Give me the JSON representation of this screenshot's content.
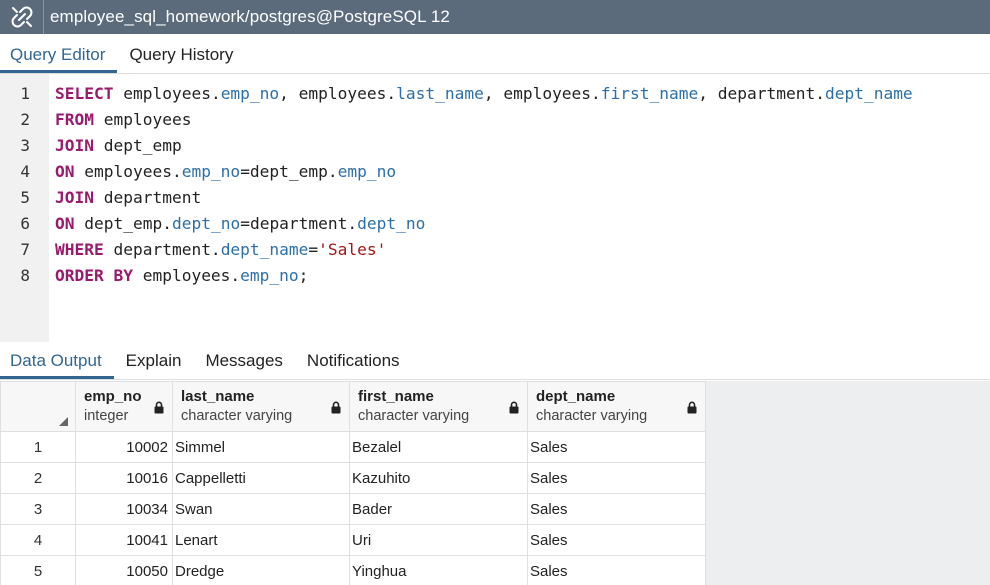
{
  "window": {
    "title": "employee_sql_homework/postgres@PostgreSQL 12",
    "icon": "connection-plug-icon"
  },
  "editor_tabs": [
    {
      "label": "Query Editor",
      "active": true
    },
    {
      "label": "Query History",
      "active": false
    }
  ],
  "editor": {
    "line_numbers": [
      "1",
      "2",
      "3",
      "4",
      "5",
      "6",
      "7",
      "8"
    ]
  },
  "output_tabs": [
    {
      "label": "Data Output",
      "active": true
    },
    {
      "label": "Explain",
      "active": false
    },
    {
      "label": "Messages",
      "active": false
    },
    {
      "label": "Notifications",
      "active": false
    }
  ],
  "grid": {
    "columns": [
      {
        "name": "emp_no",
        "type": "integer"
      },
      {
        "name": "last_name",
        "type": "character varying"
      },
      {
        "name": "first_name",
        "type": "character varying"
      },
      {
        "name": "dept_name",
        "type": "character varying"
      }
    ],
    "rows": [
      {
        "n": "1",
        "emp_no": "10002",
        "last_name": "Simmel",
        "first_name": "Bezalel",
        "dept_name": "Sales"
      },
      {
        "n": "2",
        "emp_no": "10016",
        "last_name": "Cappelletti",
        "first_name": "Kazuhito",
        "dept_name": "Sales"
      },
      {
        "n": "3",
        "emp_no": "10034",
        "last_name": "Swan",
        "first_name": "Bader",
        "dept_name": "Sales"
      },
      {
        "n": "4",
        "emp_no": "10041",
        "last_name": "Lenart",
        "first_name": "Uri",
        "dept_name": "Sales"
      },
      {
        "n": "5",
        "emp_no": "10050",
        "last_name": "Dredge",
        "first_name": "Yinghua",
        "dept_name": "Sales"
      }
    ]
  },
  "colors": {
    "titlebar": "#5b6b7c",
    "accent": "#326690",
    "keyword": "#9a1a6b",
    "identifier": "#2c6fa8",
    "string": "#a31515"
  },
  "sql_lines": [
    [
      {
        "t": "kw",
        "v": "SELECT"
      },
      {
        "t": "p",
        "v": " employees."
      },
      {
        "t": "col",
        "v": "emp_no"
      },
      {
        "t": "p",
        "v": ", employees."
      },
      {
        "t": "col",
        "v": "last_name"
      },
      {
        "t": "p",
        "v": ", employees."
      },
      {
        "t": "col",
        "v": "first_name"
      },
      {
        "t": "p",
        "v": ", department."
      },
      {
        "t": "col",
        "v": "dept_name"
      }
    ],
    [
      {
        "t": "kw",
        "v": "FROM"
      },
      {
        "t": "p",
        "v": " employees"
      }
    ],
    [
      {
        "t": "kw",
        "v": "JOIN"
      },
      {
        "t": "p",
        "v": " dept_emp"
      }
    ],
    [
      {
        "t": "kw",
        "v": "ON"
      },
      {
        "t": "p",
        "v": " employees."
      },
      {
        "t": "col",
        "v": "emp_no"
      },
      {
        "t": "p",
        "v": "=dept_emp."
      },
      {
        "t": "col",
        "v": "emp_no"
      }
    ],
    [
      {
        "t": "kw",
        "v": "JOIN"
      },
      {
        "t": "p",
        "v": " department"
      }
    ],
    [
      {
        "t": "kw",
        "v": "ON"
      },
      {
        "t": "p",
        "v": " dept_emp."
      },
      {
        "t": "col",
        "v": "dept_no"
      },
      {
        "t": "p",
        "v": "=department."
      },
      {
        "t": "col",
        "v": "dept_no"
      }
    ],
    [
      {
        "t": "kw",
        "v": "WHERE"
      },
      {
        "t": "p",
        "v": " department."
      },
      {
        "t": "col",
        "v": "dept_name"
      },
      {
        "t": "p",
        "v": "="
      },
      {
        "t": "str",
        "v": "'Sales'"
      }
    ],
    [
      {
        "t": "kw",
        "v": "ORDER BY"
      },
      {
        "t": "p",
        "v": " employees."
      },
      {
        "t": "col",
        "v": "emp_no"
      },
      {
        "t": "p",
        "v": ";"
      }
    ]
  ]
}
